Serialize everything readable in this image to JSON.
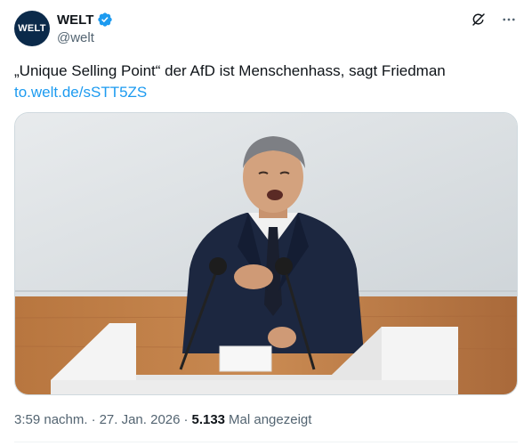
{
  "author": {
    "avatar_text": "WELT",
    "display_name": "WELT",
    "handle": "@welt",
    "verified": true
  },
  "tweet": {
    "text": "„Unique Selling Point“ der AfD ist Menschenhass, sagt Friedman",
    "link": "to.welt.de/sSTT5ZS"
  },
  "media": {
    "subject": "photo-speaker-at-podium"
  },
  "meta": {
    "time": "3:59 nachm.",
    "separator": "·",
    "date": "27. Jan. 2026",
    "views_count": "5.133",
    "views_label": "Mal angezeigt"
  },
  "icons": {
    "grok": "grok-icon",
    "more": "more-icon",
    "verified": "verified-badge-icon"
  },
  "colors": {
    "text_primary": "#0f1419",
    "text_secondary": "#536471",
    "link": "#1d9bf0",
    "avatar_bg": "#0b2a4a"
  }
}
